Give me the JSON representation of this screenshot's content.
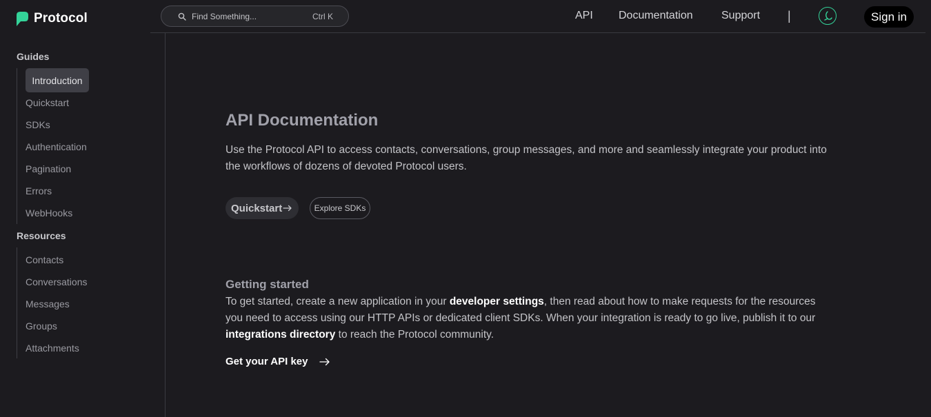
{
  "brand": {
    "name": "Protocol",
    "accent": "#34d399"
  },
  "search": {
    "placeholder": "Find Something...",
    "shortcut": "Ctrl K",
    "icon": "search-icon"
  },
  "topnav": {
    "items": [
      {
        "label": "API"
      },
      {
        "label": "Documentation"
      },
      {
        "label": "Support"
      }
    ],
    "separator": "|",
    "theme_icon": "theme-toggle-icon",
    "signin_label": "Sign in"
  },
  "sidebar": {
    "sections": [
      {
        "title": "Guides",
        "items": [
          "Introduction",
          "Quickstart",
          "SDKs",
          "Authentication",
          "Pagination",
          "Errors",
          "WebHooks"
        ],
        "active": "Introduction"
      },
      {
        "title": "Resources",
        "items": [
          "Contacts",
          "Conversations",
          "Messages",
          "Groups",
          "Attachments"
        ]
      }
    ]
  },
  "main": {
    "title": "API Documentation",
    "lead": "Use the Protocol API to access contacts, conversations, group messages, and more and seamlessly integrate your product into the workflows of dozens of devoted Protocol users.",
    "buttons": {
      "quickstart": "Quickstart",
      "explore": "Explore SDKs"
    },
    "getting_started": {
      "title": "Getting started",
      "text_1": "To get started, create a new application in your ",
      "link_1": "developer settings",
      "text_2": ", then read about how to make requests for the resources you need to access using our HTTP APIs or dedicated client SDKs. When your integration is ready to go live, publish it to our ",
      "link_2": "integrations directory",
      "text_3": " to reach the Protocol community."
    },
    "api_key_link": "Get your API key"
  }
}
